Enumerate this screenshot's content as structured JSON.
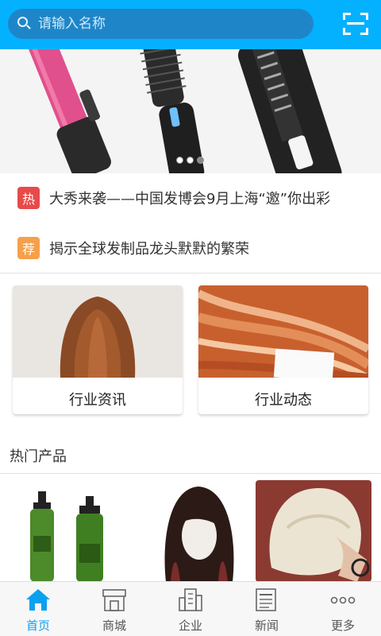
{
  "search": {
    "placeholder": "请输入名称",
    "value": ""
  },
  "banner": {
    "dots_count": 3,
    "active_dot": 3
  },
  "news": [
    {
      "tag": "热",
      "tag_color": "#e84a4a",
      "text": "大秀来袭——中国发博会9月上海“邀”你出彩"
    },
    {
      "tag": "荐",
      "tag_color": "#f5a04a",
      "text": "揭示全球发制品龙头默默的繁荣"
    }
  ],
  "cards": [
    {
      "label": "行业资讯"
    },
    {
      "label": "行业动态"
    }
  ],
  "section": {
    "title": "热门产品"
  },
  "tabs": [
    {
      "label": "首页",
      "icon": "home-icon",
      "active": true
    },
    {
      "label": "商城",
      "icon": "store-icon",
      "active": false
    },
    {
      "label": "企业",
      "icon": "building-icon",
      "active": false
    },
    {
      "label": "新闻",
      "icon": "news-icon",
      "active": false
    },
    {
      "label": "更多",
      "icon": "more-icon",
      "active": false
    }
  ],
  "colors": {
    "accent": "#04b1ff",
    "active_tab": "#0aa0f0"
  }
}
